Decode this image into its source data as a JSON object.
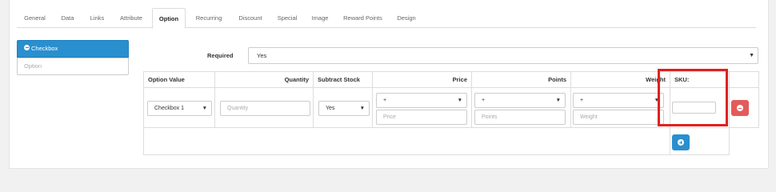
{
  "tabs": [
    {
      "label": "General"
    },
    {
      "label": "Data"
    },
    {
      "label": "Links"
    },
    {
      "label": "Attribute"
    },
    {
      "label": "Option"
    },
    {
      "label": "Recurring"
    },
    {
      "label": "Discount"
    },
    {
      "label": "Special"
    },
    {
      "label": "Image"
    },
    {
      "label": "Reward Points"
    },
    {
      "label": "Design"
    }
  ],
  "sidebar": {
    "active_item": "Checkbox",
    "option_placeholder": "Option"
  },
  "required": {
    "label": "Required",
    "value": "Yes"
  },
  "table": {
    "headers": {
      "option_value": "Option Value",
      "quantity": "Quantity",
      "subtract_stock": "Subtract Stock",
      "price": "Price",
      "points": "Points",
      "weight": "Weight",
      "sku": "SKU:"
    },
    "row": {
      "option_value": "Checkbox 1",
      "quantity_placeholder": "Quantity",
      "subtract_stock": "Yes",
      "price_prefix": "+",
      "price_placeholder": "Price",
      "points_prefix": "+",
      "points_placeholder": "Points",
      "weight_prefix": "+",
      "weight_placeholder": "Weight",
      "sku_value": ""
    }
  },
  "colors": {
    "primary": "#2a8fce",
    "danger": "#e35b5b",
    "highlight": "#e02020"
  }
}
